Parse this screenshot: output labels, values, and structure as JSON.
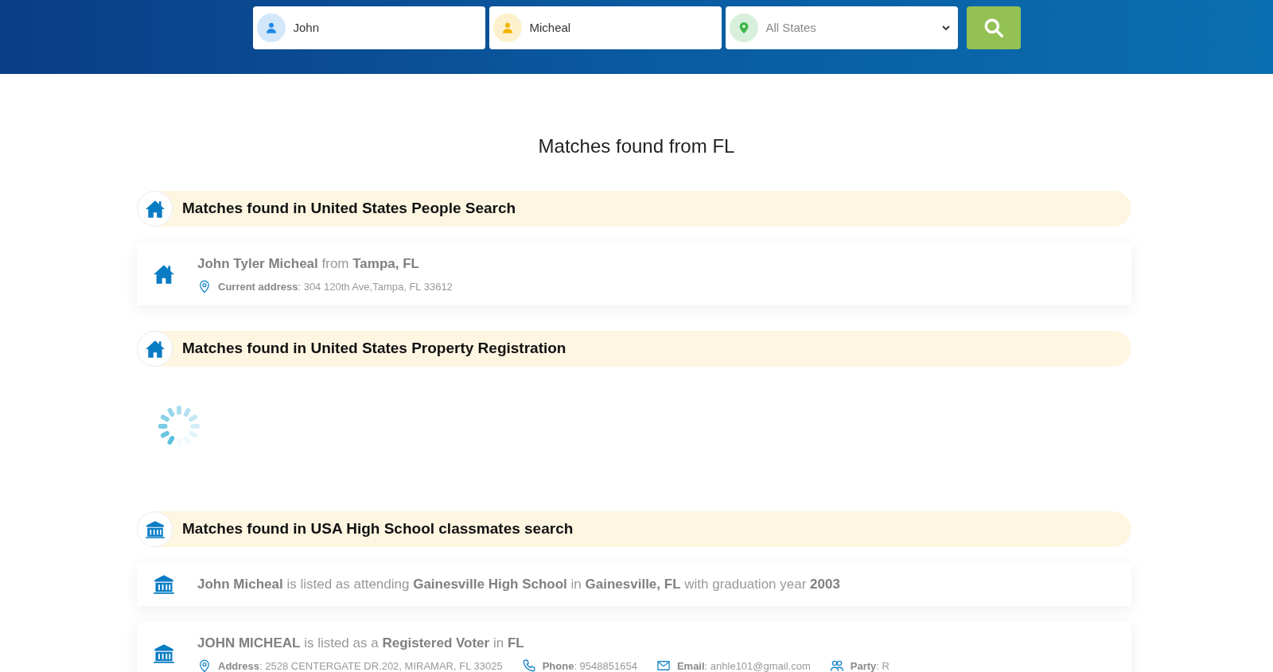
{
  "search": {
    "fields": [
      {
        "kind": "person",
        "color": "#1e88e5",
        "value": "John"
      },
      {
        "kind": "person",
        "color": "#f5b400",
        "value": "Micheal"
      },
      {
        "kind": "select",
        "color": "#3bb54a",
        "value": "All States"
      }
    ]
  },
  "heading": "Matches found from FL",
  "sections": [
    {
      "title": "Matches found in United States People Search",
      "kind": "house",
      "results": [
        {
          "text": "**John Tyler Micheal** from **Tampa, FL**",
          "details": [
            {
              "kind": "location",
              "text": "**Current address**: 304 120th Ave,Tampa, FL 33612"
            }
          ]
        }
      ]
    },
    {
      "title": "Matches found in United States Property Registration",
      "kind": "house",
      "loading": true
    },
    {
      "title": "Matches found in USA High School classmates search",
      "kind": "school",
      "results": [
        {
          "text": "**John Micheal** is listed as attending **Gainesville High School** in **Gainesville, FL** with graduation year **2003**"
        },
        {
          "text": "**JOHN MICHEAL** is listed as a **Registered Voter** in **FL**",
          "details": [
            {
              "kind": "location",
              "text": "**Address**: 2528 CENTERGATE DR.202, MIRAMAR, FL 33025"
            },
            {
              "kind": "phone",
              "text": "**Phone**: 9548851654"
            },
            {
              "kind": "email",
              "text": "**Email**: anhle101@gmail.com"
            },
            {
              "kind": "party",
              "text": "**Party**: R"
            }
          ]
        }
      ]
    }
  ]
}
